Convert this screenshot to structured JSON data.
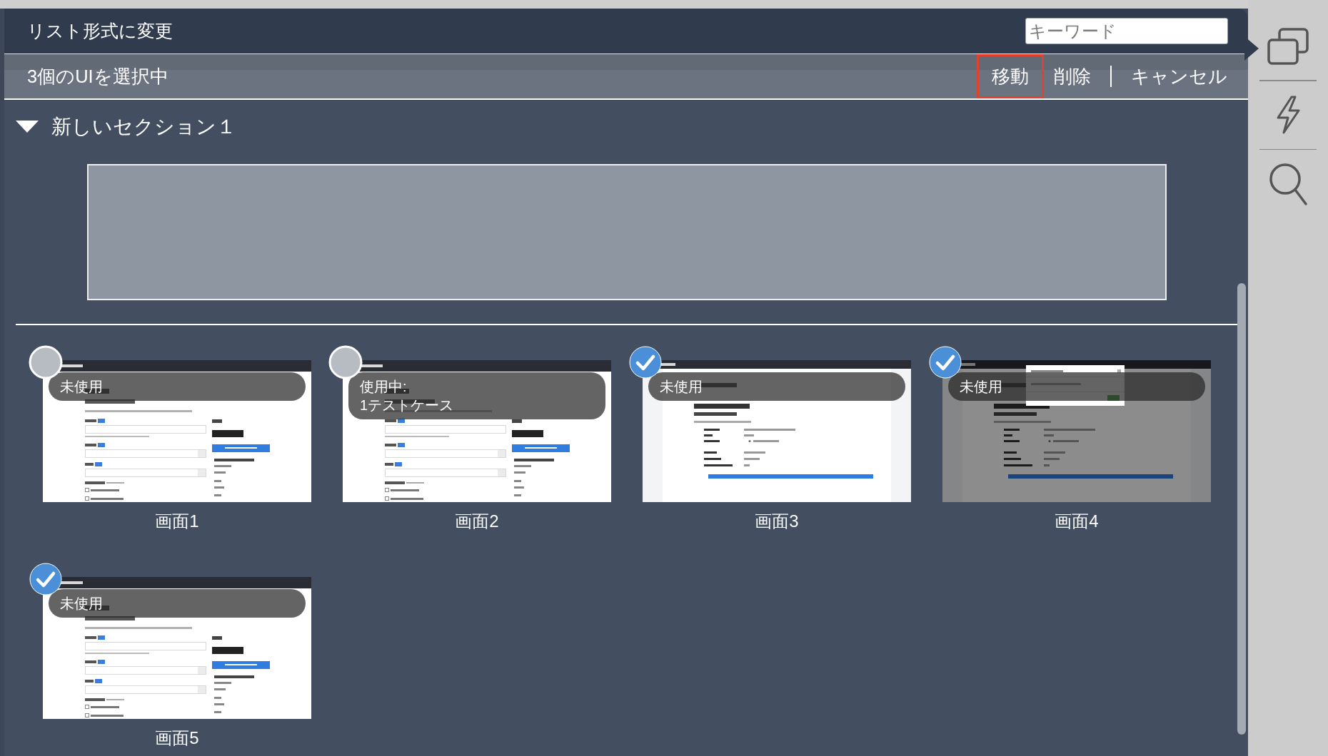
{
  "panel": {
    "title": "リスト形式に変更",
    "search": {
      "placeholder": "キーワード"
    }
  },
  "selection_bar": {
    "summary": "3個のUIを選択中",
    "action_groups": [
      [
        {
          "label": "移動",
          "highlighted": true
        },
        {
          "label": "削除",
          "highlighted": false
        }
      ],
      [
        {
          "label": "キャンセル",
          "highlighted": false
        }
      ]
    ]
  },
  "section": {
    "title": "新しいセクション１",
    "expanded": true,
    "screens": [
      {
        "name": "画面1",
        "selected": false,
        "status": [
          "未使用"
        ],
        "thumbnail": {
          "kind": "form"
        }
      },
      {
        "name": "画面2",
        "selected": false,
        "status": [
          "使用中:",
          "1テストケース"
        ],
        "thumbnail": {
          "kind": "form"
        }
      },
      {
        "name": "画面3",
        "selected": true,
        "status": [
          "未使用"
        ],
        "thumbnail": {
          "kind": "confirmation"
        }
      },
      {
        "name": "画面4",
        "selected": true,
        "status": [
          "未使用"
        ],
        "thumbnail": {
          "kind": "dialog"
        }
      },
      {
        "name": "画面5",
        "selected": true,
        "status": [
          "未使用"
        ],
        "thumbnail": {
          "kind": "form"
        }
      }
    ]
  },
  "sidebar": {
    "items": [
      {
        "kind": "windows",
        "selected": true
      },
      {
        "kind": "bolt",
        "selected": false
      },
      {
        "kind": "search",
        "selected": false
      }
    ]
  }
}
